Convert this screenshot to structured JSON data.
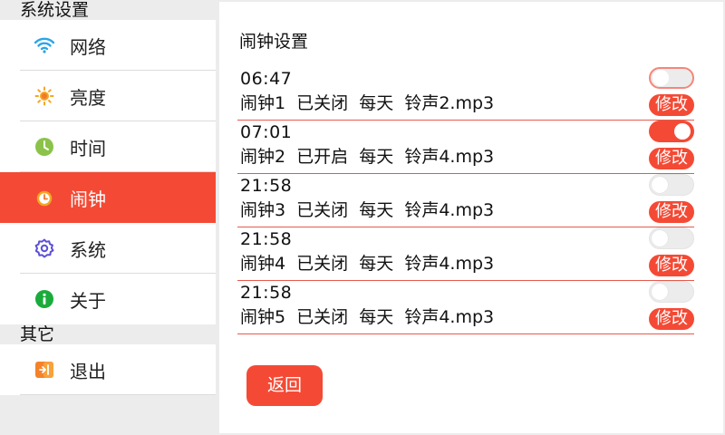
{
  "sidebar": {
    "sections": [
      {
        "header": "系统设置",
        "items": [
          {
            "label": "网络",
            "icon": "wifi-icon",
            "active": false
          },
          {
            "label": "亮度",
            "icon": "brightness-icon",
            "active": false
          },
          {
            "label": "时间",
            "icon": "clock-icon",
            "active": false
          },
          {
            "label": "闹钟",
            "icon": "alarm-clock-icon",
            "active": true
          },
          {
            "label": "系统",
            "icon": "gear-icon",
            "active": false
          },
          {
            "label": "关于",
            "icon": "info-icon",
            "active": false
          }
        ]
      },
      {
        "header": "其它",
        "items": [
          {
            "label": "退出",
            "icon": "exit-icon",
            "active": false
          }
        ]
      }
    ]
  },
  "main": {
    "title": "闹钟设置",
    "alarms": [
      {
        "time": "06:47",
        "info": "闹钟1  已关闭  每天  铃声2.mp3",
        "enabled": false,
        "focused": true,
        "edit_label": "修改"
      },
      {
        "time": "07:01",
        "info": "闹钟2  已开启  每天  铃声4.mp3",
        "enabled": true,
        "focused": false,
        "edit_label": "修改"
      },
      {
        "time": "21:58",
        "info": "闹钟3  已关闭  每天  铃声4.mp3",
        "enabled": false,
        "focused": false,
        "edit_label": "修改"
      },
      {
        "time": "21:58",
        "info": "闹钟4  已关闭  每天  铃声4.mp3",
        "enabled": false,
        "focused": false,
        "edit_label": "修改"
      },
      {
        "time": "21:58",
        "info": "闹钟5  已关闭  每天  铃声4.mp3",
        "enabled": false,
        "focused": false,
        "edit_label": "修改"
      }
    ],
    "back_label": "返回"
  },
  "colors": {
    "accent": "#f44a35",
    "separator": "#e65a4c"
  }
}
